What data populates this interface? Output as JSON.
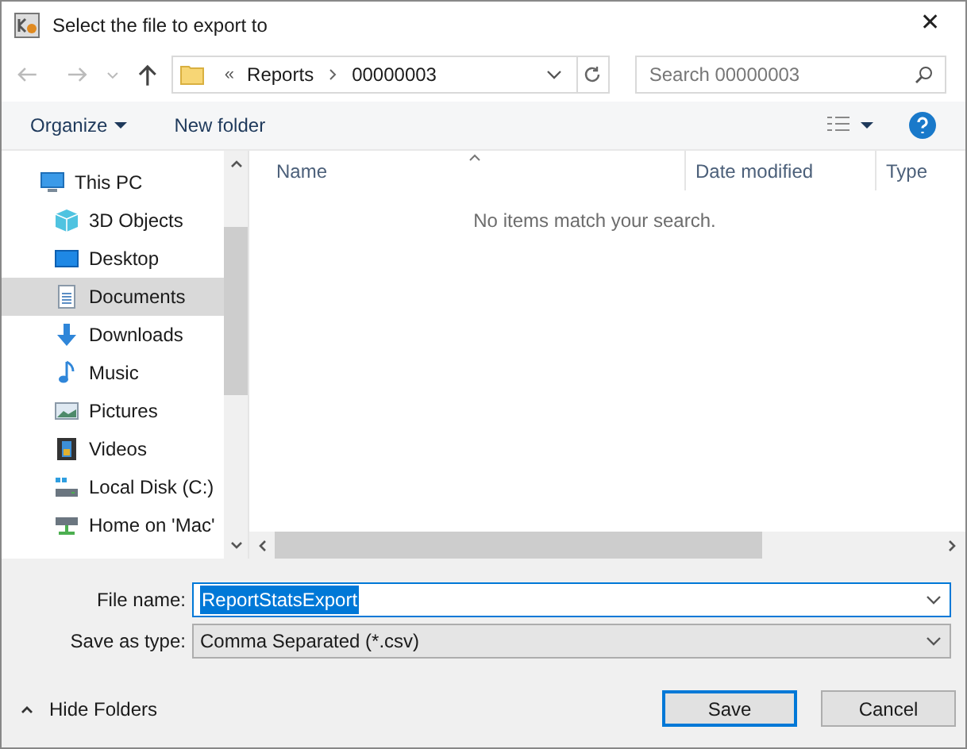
{
  "window": {
    "title": "Select the file to export to",
    "close": "✕"
  },
  "address": {
    "overflow": "«",
    "crumbs": [
      "Reports",
      "00000003"
    ]
  },
  "search": {
    "placeholder": "Search 00000003"
  },
  "toolbar": {
    "organize": "Organize",
    "new_folder": "New folder"
  },
  "sidebar": {
    "items": [
      {
        "label": "This PC",
        "kind": "pc",
        "selected": false,
        "child": false
      },
      {
        "label": "3D Objects",
        "kind": "cube",
        "selected": false,
        "child": true
      },
      {
        "label": "Desktop",
        "kind": "desktop",
        "selected": false,
        "child": true
      },
      {
        "label": "Documents",
        "kind": "documents",
        "selected": true,
        "child": true
      },
      {
        "label": "Downloads",
        "kind": "downloads",
        "selected": false,
        "child": true
      },
      {
        "label": "Music",
        "kind": "music",
        "selected": false,
        "child": true
      },
      {
        "label": "Pictures",
        "kind": "pictures",
        "selected": false,
        "child": true
      },
      {
        "label": "Videos",
        "kind": "videos",
        "selected": false,
        "child": true
      },
      {
        "label": "Local Disk (C:)",
        "kind": "disk",
        "selected": false,
        "child": true
      },
      {
        "label": "Home on 'Mac'",
        "kind": "netdrive",
        "selected": false,
        "child": true
      }
    ]
  },
  "table": {
    "columns": [
      "Name",
      "Date modified",
      "Type"
    ],
    "empty_message": "No items match your search."
  },
  "file_name": {
    "label": "File name:",
    "value": "ReportStatsExport"
  },
  "save_as_type": {
    "label": "Save as type:",
    "value": "Comma Separated (*.csv)"
  },
  "hide_folders": "Hide Folders",
  "buttons": [
    {
      "label": "Save",
      "default": true
    },
    {
      "label": "Cancel",
      "default": false
    }
  ]
}
